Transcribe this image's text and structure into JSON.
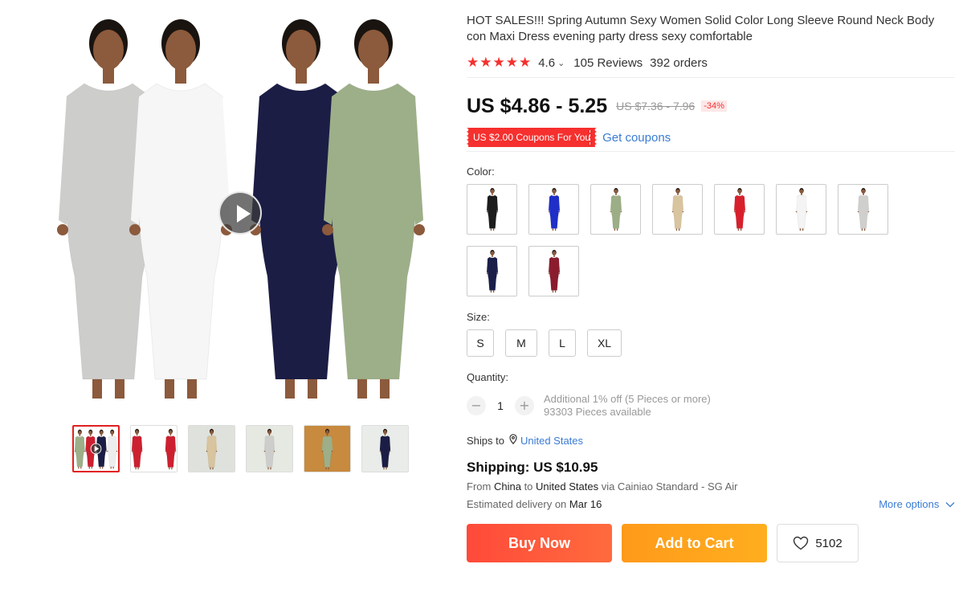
{
  "product": {
    "title": "HOT SALES!!! Spring Autumn Sexy Women Solid Color Long Sleeve Round Neck Body con Maxi Dress evening party dress sexy comfortable",
    "stars": "★★★★★",
    "rating": "4.6",
    "reviews": "105 Reviews",
    "orders": "392 orders"
  },
  "price": {
    "current": "US $4.86 - 5.25",
    "original": "US $7.36 - 7.96",
    "discount": "-34%"
  },
  "coupon": {
    "badge": "US $2.00 Coupons For You",
    "link": "Get coupons"
  },
  "color": {
    "label": "Color:",
    "options": [
      {
        "name": "black",
        "hex": "#1c1c1c"
      },
      {
        "name": "blue",
        "hex": "#1f2fc8"
      },
      {
        "name": "green",
        "hex": "#9cae86"
      },
      {
        "name": "khaki",
        "hex": "#d8c49e"
      },
      {
        "name": "red",
        "hex": "#d8202c"
      },
      {
        "name": "white",
        "hex": "#f4f4f4"
      },
      {
        "name": "gray",
        "hex": "#cfcfcd"
      },
      {
        "name": "navy",
        "hex": "#1a1f4a"
      },
      {
        "name": "wine",
        "hex": "#8a1c2e"
      }
    ]
  },
  "size": {
    "label": "Size:",
    "options": [
      "S",
      "M",
      "L",
      "XL"
    ]
  },
  "quantity": {
    "label": "Quantity:",
    "minus": "−",
    "plus": "+",
    "value": "1",
    "note": "Additional 1% off (5 Pieces or more)",
    "available": "93303 Pieces available"
  },
  "shipping": {
    "ships_to_label": "Ships to",
    "ships_to_country": "United States",
    "title": "Shipping: US $10.95",
    "from_word": "From",
    "from_country": "China",
    "to_word": "to",
    "to_country": "United States",
    "via": "via Cainiao Standard - SG Air",
    "eta_prefix": "Estimated delivery on",
    "eta_date": "Mar 16",
    "more_options": "More options"
  },
  "actions": {
    "buy": "Buy Now",
    "cart": "Add to Cart",
    "wishlist_count": "5102"
  },
  "gallery": {
    "main_dress_colors": [
      "#cdcdcb",
      "#9daf88",
      "#1b1d45",
      "#f6f6f6"
    ],
    "skin": "#8c5a3c",
    "thumbnails": [
      {
        "name": "four-colors-video",
        "colors": [
          "#9daf88",
          "#cc2030",
          "#1b1d45",
          "#ededed"
        ],
        "bg": "#ffffff"
      },
      {
        "name": "red-pair",
        "colors": [
          "#cc2030",
          "#cc2030"
        ],
        "bg": "#ffffff"
      },
      {
        "name": "khaki-outdoor",
        "colors": [
          "#d8c49e"
        ],
        "bg": "#dfe2dc"
      },
      {
        "name": "gray-outdoor",
        "colors": [
          "#cdcdcb"
        ],
        "bg": "#e6e8e2"
      },
      {
        "name": "green-indoor",
        "colors": [
          "#9daf88"
        ],
        "bg": "#c78a3e"
      },
      {
        "name": "navy-studio",
        "colors": [
          "#1b1d45"
        ],
        "bg": "#e9ece8"
      }
    ]
  }
}
